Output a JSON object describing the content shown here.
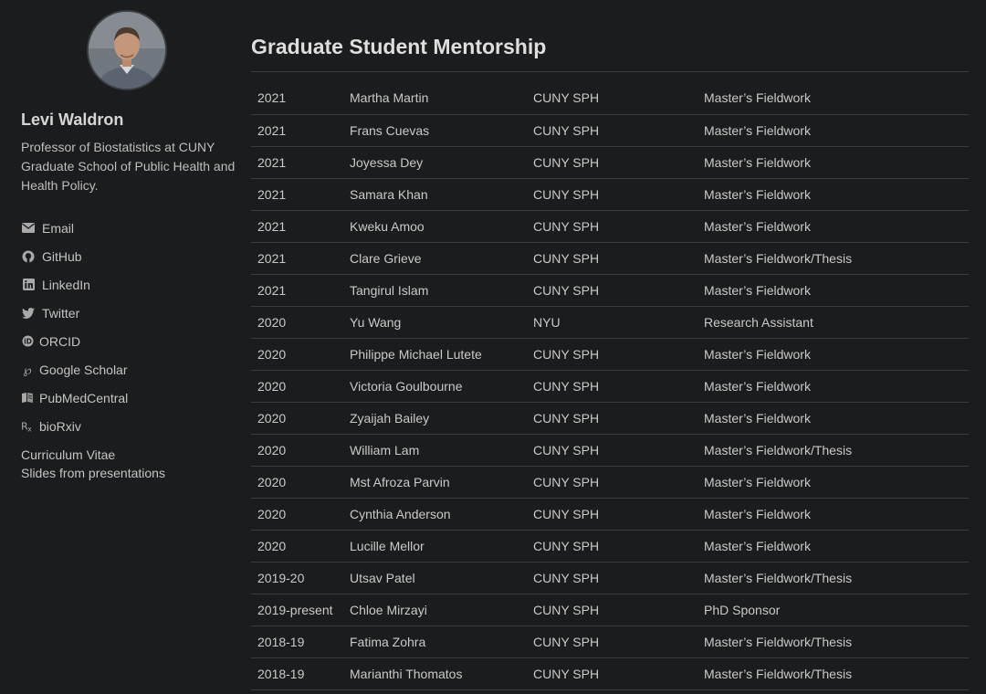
{
  "author": {
    "name": "Levi Waldron",
    "bio": "Professor of Biostatistics at CUNY Graduate School of Public Health and Health Policy."
  },
  "links": [
    {
      "label": "Email",
      "icon": "envelope-icon"
    },
    {
      "label": "GitHub",
      "icon": "github-icon"
    },
    {
      "label": "LinkedIn",
      "icon": "linkedin-icon"
    },
    {
      "label": "Twitter",
      "icon": "twitter-icon"
    },
    {
      "label": "ORCID",
      "icon": "orcid-icon"
    },
    {
      "label": "Google Scholar",
      "icon": "google-scholar-icon"
    },
    {
      "label": "PubMedCentral",
      "icon": "pubmed-icon"
    },
    {
      "label": "bioRxiv",
      "icon": "biorxiv-icon"
    }
  ],
  "extra_links": [
    "Curriculum Vitae",
    "Slides from presentations"
  ],
  "main": {
    "title": "Graduate Student Mentorship",
    "rows": [
      {
        "year": "2021",
        "name": "Martha Martin",
        "institution": "CUNY SPH",
        "type": "Master’s Fieldwork"
      },
      {
        "year": "2021",
        "name": "Frans Cuevas",
        "institution": "CUNY SPH",
        "type": "Master’s Fieldwork"
      },
      {
        "year": "2021",
        "name": "Joyessa Dey",
        "institution": "CUNY SPH",
        "type": "Master’s Fieldwork"
      },
      {
        "year": "2021",
        "name": "Samara Khan",
        "institution": "CUNY SPH",
        "type": "Master’s Fieldwork"
      },
      {
        "year": "2021",
        "name": "Kweku Amoo",
        "institution": "CUNY SPH",
        "type": "Master’s Fieldwork"
      },
      {
        "year": "2021",
        "name": "Clare Grieve",
        "institution": "CUNY SPH",
        "type": "Master’s Fieldwork/Thesis"
      },
      {
        "year": "2021",
        "name": "Tangirul Islam",
        "institution": "CUNY SPH",
        "type": "Master’s Fieldwork"
      },
      {
        "year": "2020",
        "name": "Yu Wang",
        "institution": "NYU",
        "type": "Research Assistant"
      },
      {
        "year": "2020",
        "name": "Philippe Michael Lutete",
        "institution": "CUNY SPH",
        "type": "Master’s Fieldwork"
      },
      {
        "year": "2020",
        "name": "Victoria Goulbourne",
        "institution": "CUNY SPH",
        "type": "Master’s Fieldwork"
      },
      {
        "year": "2020",
        "name": "Zyaijah Bailey",
        "institution": "CUNY SPH",
        "type": "Master’s Fieldwork"
      },
      {
        "year": "2020",
        "name": "William Lam",
        "institution": "CUNY SPH",
        "type": "Master’s Fieldwork/Thesis"
      },
      {
        "year": "2020",
        "name": "Mst Afroza Parvin",
        "institution": "CUNY SPH",
        "type": "Master’s Fieldwork"
      },
      {
        "year": "2020",
        "name": "Cynthia Anderson",
        "institution": "CUNY SPH",
        "type": "Master’s Fieldwork"
      },
      {
        "year": "2020",
        "name": "Lucille Mellor",
        "institution": "CUNY SPH",
        "type": "Master’s Fieldwork"
      },
      {
        "year": "2019-20",
        "name": "Utsav Patel",
        "institution": "CUNY SPH",
        "type": "Master’s Fieldwork/Thesis"
      },
      {
        "year": "2019-present",
        "name": "Chloe Mirzayi",
        "institution": "CUNY SPH",
        "type": "PhD Sponsor"
      },
      {
        "year": "2018-19",
        "name": "Fatima Zohra",
        "institution": "CUNY SPH",
        "type": "Master’s Fieldwork/Thesis"
      },
      {
        "year": "2018-19",
        "name": "Marianthi Thomatos",
        "institution": "CUNY SPH",
        "type": "Master’s Fieldwork/Thesis"
      }
    ]
  }
}
